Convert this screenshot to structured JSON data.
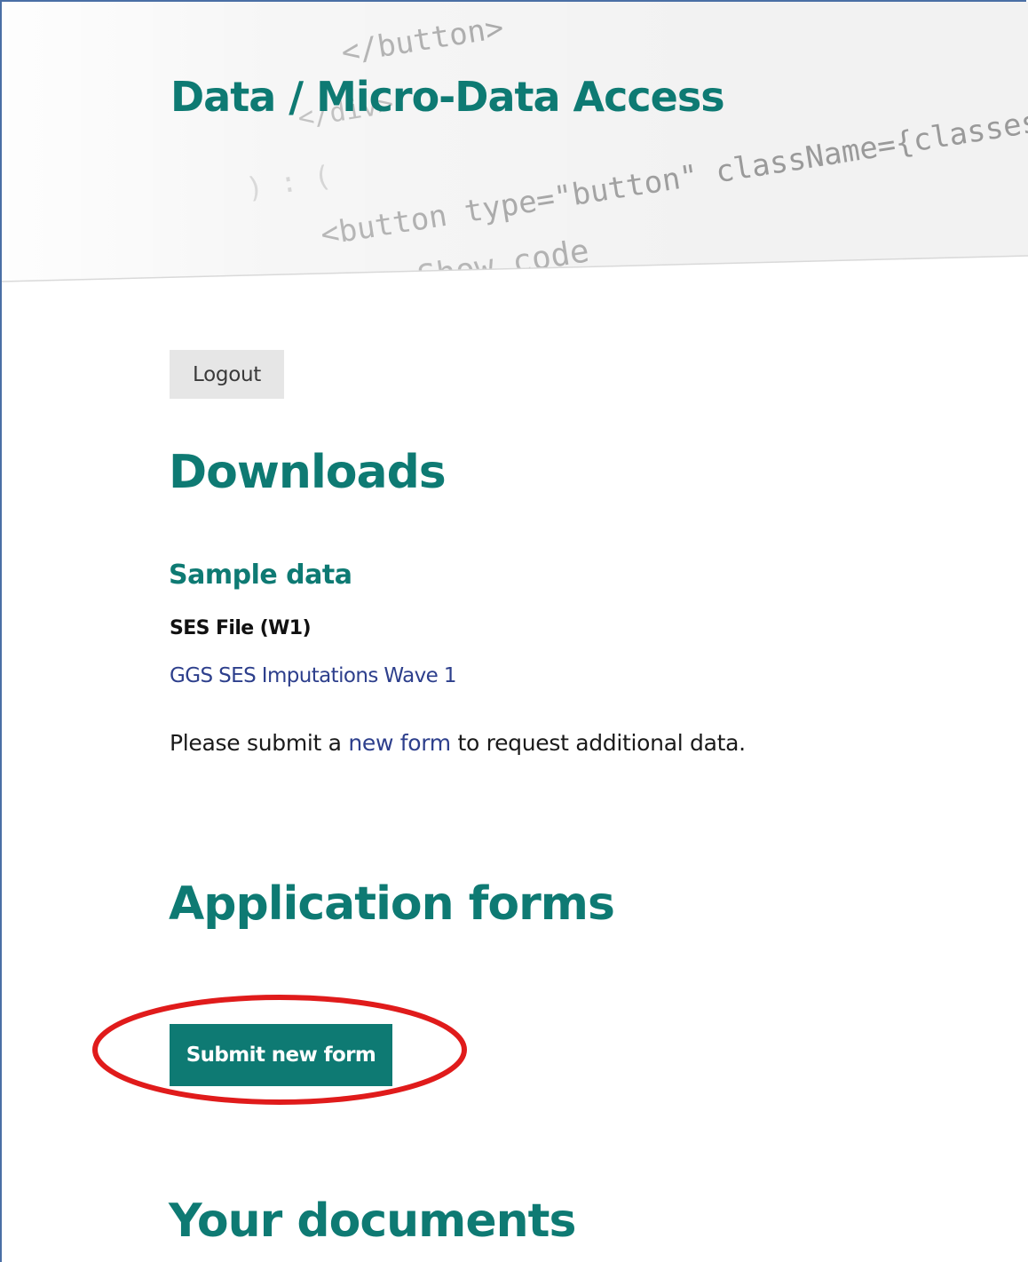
{
  "hero": {
    "title": "Data / Micro-Data Access",
    "code_lines": [
      "</button>",
      "</div>",
      ") : (",
      "<button type=\"button\" className={classes.showCod",
      "Show code"
    ]
  },
  "auth": {
    "logout_label": "Logout"
  },
  "downloads": {
    "heading": "Downloads",
    "sample_heading": "Sample data",
    "file_label": "SES File (W1)",
    "file_link": "GGS SES Imputations Wave 1",
    "request_prefix": "Please submit a ",
    "request_link": "new form",
    "request_suffix": " to request additional data."
  },
  "application_forms": {
    "heading": "Application forms",
    "submit_label": "Submit new form"
  },
  "documents": {
    "heading": "Your documents"
  },
  "colors": {
    "brand_teal": "#0e7a73",
    "link_blue": "#2d3f8c",
    "annotation_red": "#e01b1b",
    "button_grey": "#e6e6e6"
  }
}
